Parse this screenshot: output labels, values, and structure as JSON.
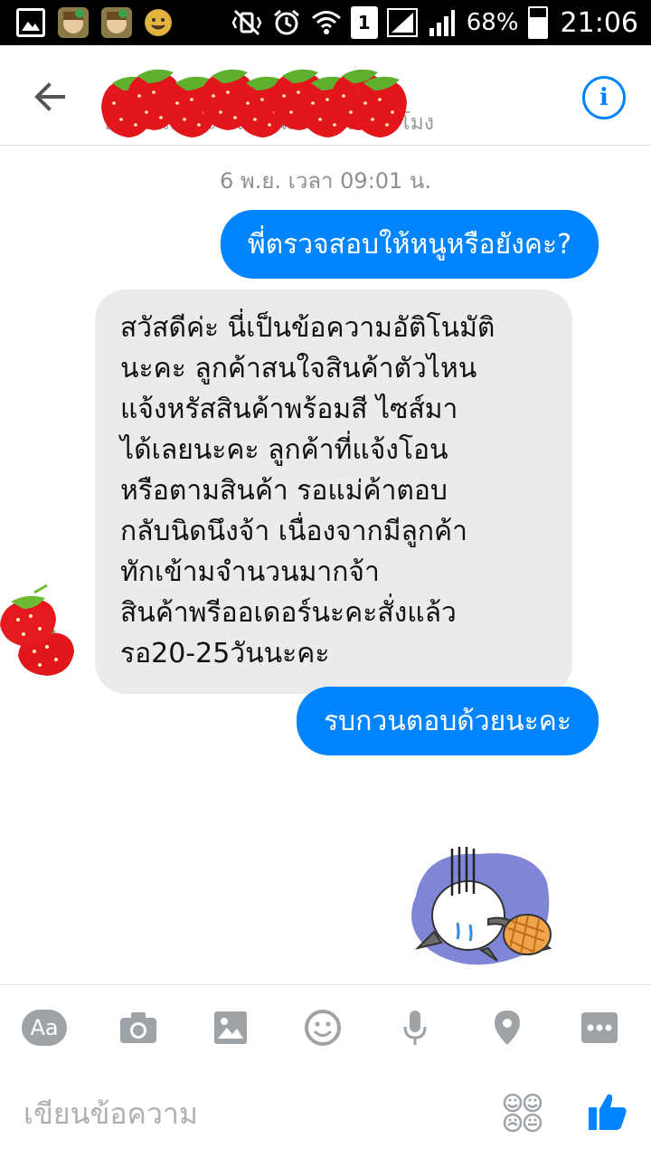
{
  "status_bar": {
    "battery_percent": "68%",
    "battery_level": 0.68,
    "sim_slot": "1",
    "time": "21:06",
    "icons": [
      "gallery-icon",
      "app-avatar-icon",
      "app-avatar-icon",
      "emoji-face-icon",
      "vibrate-mute-icon",
      "alarm-icon",
      "wifi-icon",
      "sim-icon",
      "signal-icon",
      "signal-icon",
      "battery-charging-icon"
    ]
  },
  "header": {
    "back_icon": "arrow-left-icon",
    "subtitle_visible": "บกติดแล้วจะ  กลับในเวลา  ไม่กี่ชั่วโมง",
    "info_label": "i",
    "accent_color": "#0084ff"
  },
  "conversation": {
    "timestamp": "6 พ.ย. เวลา 09:01 น.",
    "messages": [
      {
        "direction": "outgoing",
        "text": "พี่ตรวจสอบให้หนูหรือยังคะ?"
      },
      {
        "direction": "incoming",
        "lines": [
          "สวัสดีค่ะ นี่เป็นข้อความอัติโนมัติ",
          "นะคะ ลูกค้าสนใจสินค้าตัวไหน",
          "แจ้งหรัสสินค้าพร้อมสี ไซส์มา",
          "ได้เลยนะคะ ลูกค้าที่แจ้งโอน",
          "หรือตามสินค้า รอแม่ค้าตอบ",
          "กลับนิดนึงจ้า เนื่องจากมีลูกค้า",
          "ทักเข้ามจำนวนมากจ้า",
          "สินค้าพรีออเดอร์นะคะสั่งแล้ว",
          "รอ20-25วันนะคะ"
        ]
      },
      {
        "direction": "outgoing",
        "text": "รบกวนตอบด้วยนะคะ"
      }
    ]
  },
  "composer": {
    "aa_label": "Aa",
    "tools": [
      "camera-icon",
      "image-icon",
      "emoji-icon",
      "microphone-icon",
      "location-pin-icon",
      "more-icon"
    ],
    "placeholder": "เขียนข้อความ",
    "like_icon": "thumbs-up-icon"
  }
}
